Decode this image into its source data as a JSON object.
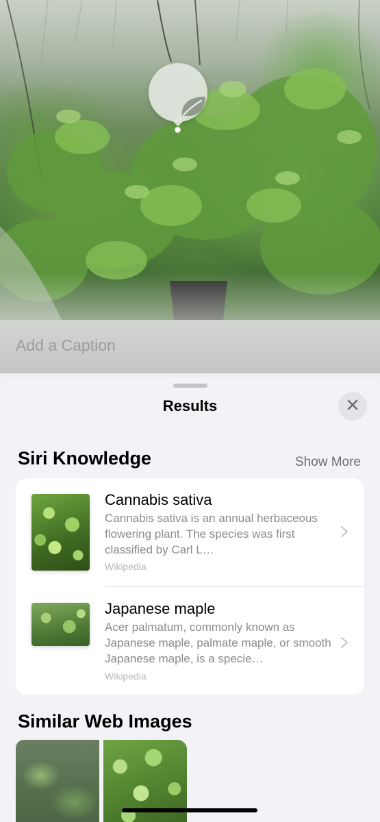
{
  "photo": {
    "lookup_icon": "leaf-icon"
  },
  "caption": {
    "placeholder": "Add a Caption"
  },
  "sheet": {
    "title": "Results",
    "close_icon": "close-icon"
  },
  "siri_knowledge": {
    "title": "Siri Knowledge",
    "show_more": "Show More",
    "results": [
      {
        "title": "Cannabis sativa",
        "description": "Cannabis sativa is an annual herbaceous flowering plant. The species was first classified by Carl L…",
        "source": "Wikipedia"
      },
      {
        "title": "Japanese maple",
        "description": "Acer palmatum, commonly known as Japanese maple, palmate maple, or smooth Japanese maple, is a specie…",
        "source": "Wikipedia"
      }
    ]
  },
  "similar_web_images": {
    "title": "Similar Web Images"
  }
}
